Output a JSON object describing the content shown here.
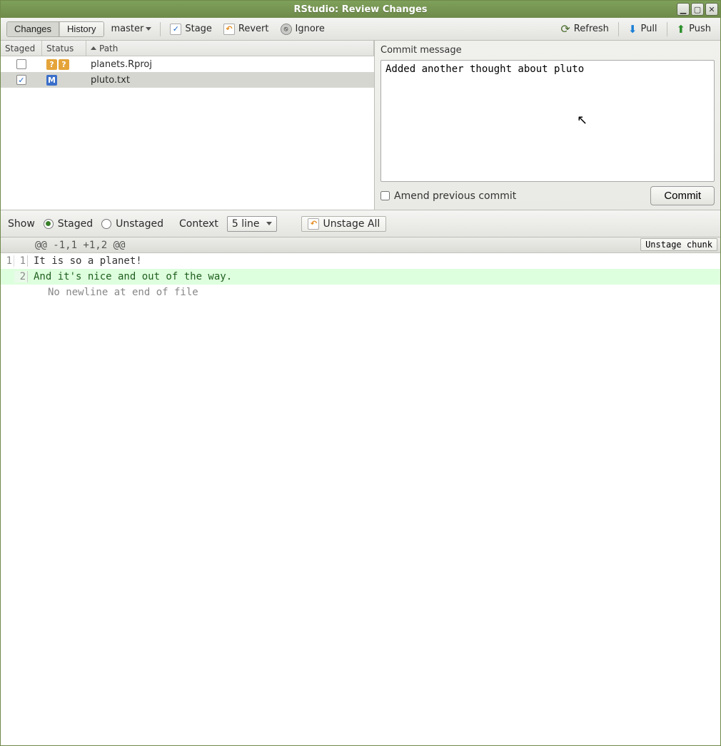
{
  "window": {
    "title": "RStudio: Review Changes"
  },
  "toolbar": {
    "tab_changes": "Changes",
    "tab_history": "History",
    "branch": "master",
    "stage": "Stage",
    "revert": "Revert",
    "ignore": "Ignore",
    "refresh": "Refresh",
    "pull": "Pull",
    "push": "Push"
  },
  "file_table": {
    "headers": {
      "staged": "Staged",
      "status": "Status",
      "path": "Path"
    },
    "rows": [
      {
        "staged": false,
        "status": "??",
        "status_color": "q",
        "path": "planets.Rproj",
        "selected": false
      },
      {
        "staged": true,
        "status": "M",
        "status_color": "m",
        "path": "pluto.txt",
        "selected": true
      }
    ]
  },
  "commit": {
    "label": "Commit message",
    "message": "Added another thought about pluto",
    "amend_label": "Amend previous commit",
    "amend_checked": false,
    "button": "Commit"
  },
  "diff_toolbar": {
    "show_label": "Show",
    "staged_label": "Staged",
    "unstaged_label": "Unstaged",
    "show_selected": "staged",
    "context_label": "Context",
    "context_value": "5 line",
    "unstage_all": "Unstage All"
  },
  "diff": {
    "hunk": "@@ -1,1 +1,2 @@",
    "unstage_chunk": "Unstage chunk",
    "lines": [
      {
        "old": "1",
        "new": "1",
        "type": "ctx",
        "text": "It is so a planet!"
      },
      {
        "old": "",
        "new": "2",
        "type": "add",
        "text": "And it's nice and out of the way."
      },
      {
        "old": "",
        "new": "",
        "type": "meta",
        "text": "No newline at end of file"
      }
    ]
  }
}
